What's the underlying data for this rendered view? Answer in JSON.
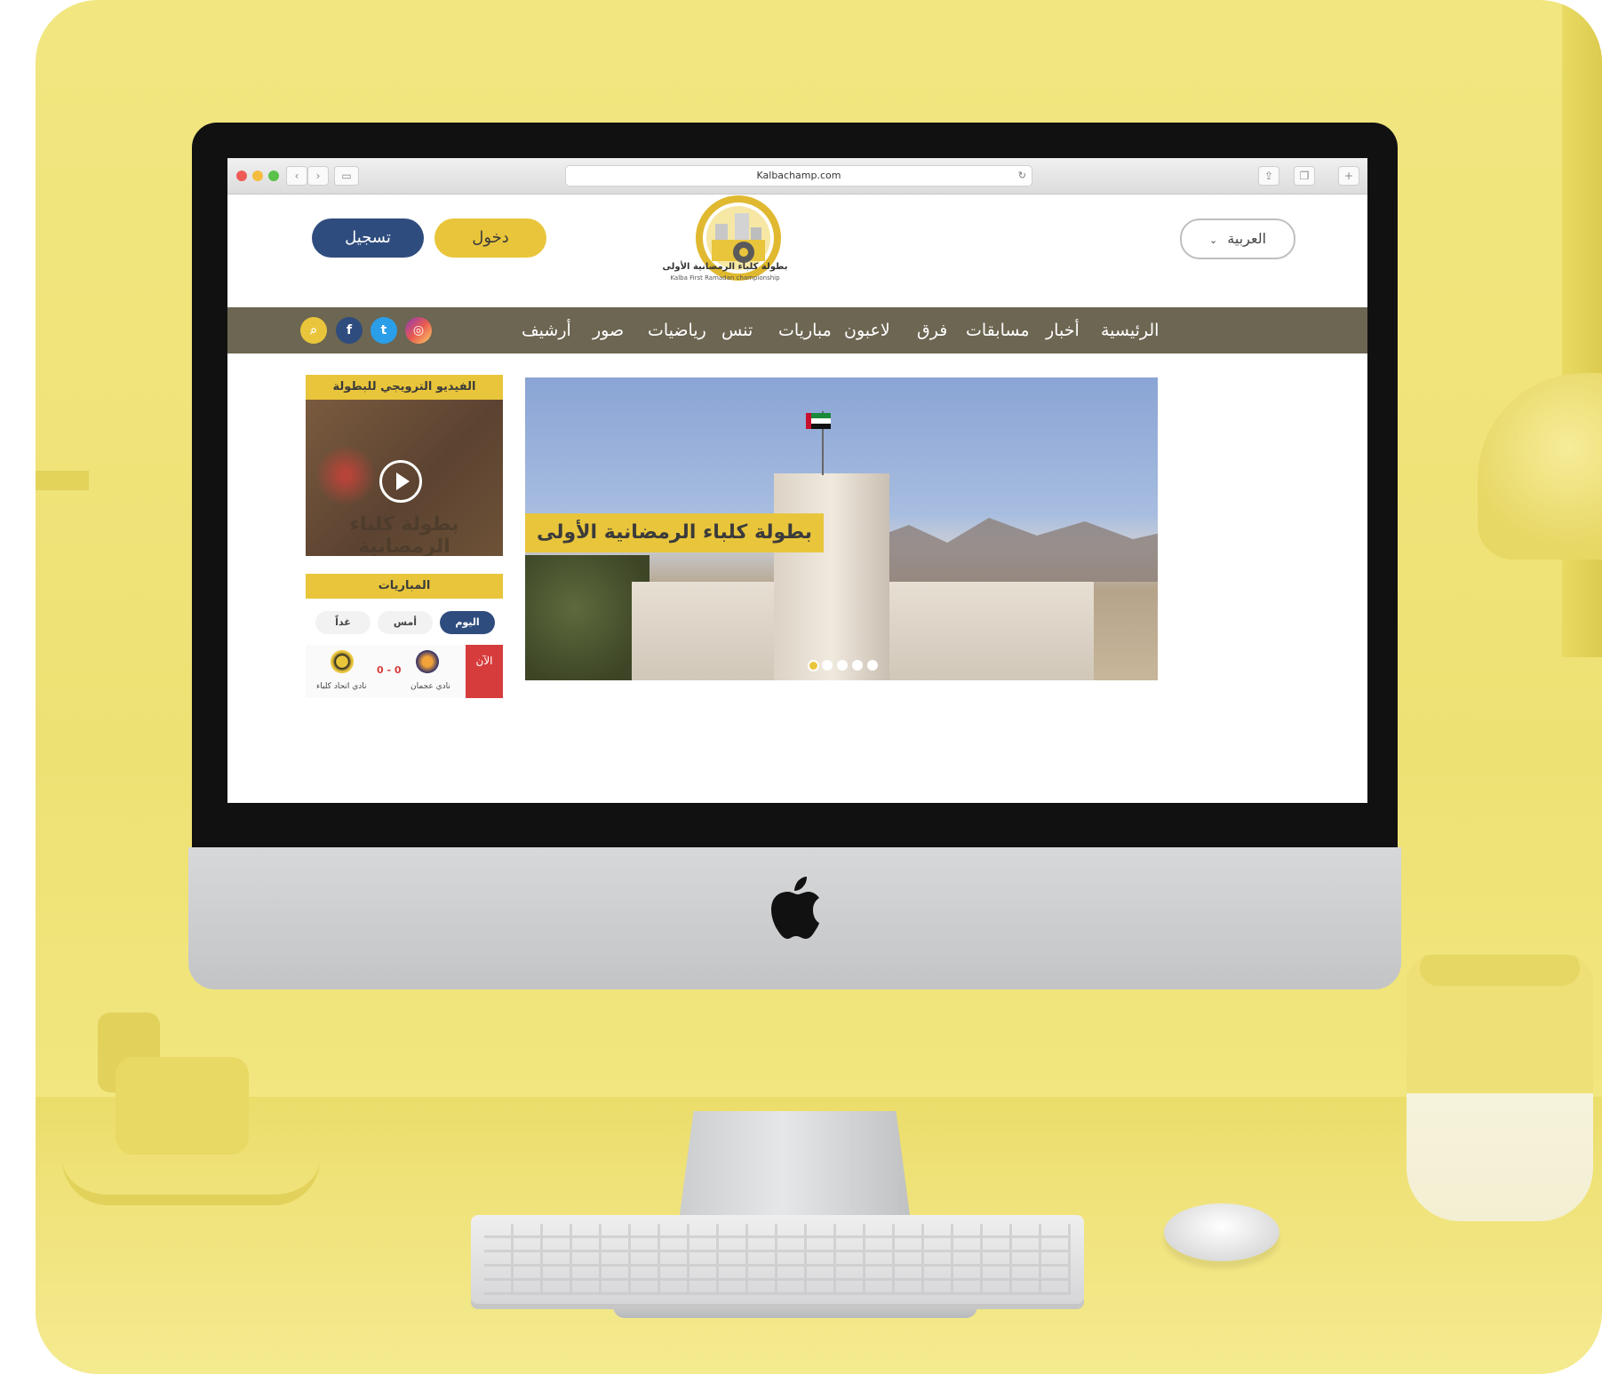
{
  "browser": {
    "url": "Kalbachamp.com"
  },
  "header": {
    "register_label": "تسجيل",
    "login_label": "دخول",
    "language_label": "العربية",
    "logo_title_ar": "بطولة كلباء الرمضانية الأولى",
    "logo_title_en": "Kalba First Ramadan championship"
  },
  "nav": {
    "items": [
      "الرئيسية",
      "أخبار",
      "مسابقات",
      "فرق",
      "لاعبون",
      "مباريات",
      "تنس",
      "رياضيات",
      "صور",
      "أرشيف"
    ]
  },
  "video_card": {
    "title": "الفيديو الترويجي للبطولة",
    "thumb_text": "بطولة كلباء الرمضانية"
  },
  "matches": {
    "title": "المباريات",
    "tabs": [
      "اليوم",
      "أمس",
      "غداً"
    ],
    "live_label": "الآن",
    "score": "0 - 0",
    "home_team": "نادي عجمان",
    "away_team": "نادي اتحاد كلباء"
  },
  "slider": {
    "caption": "بطولة كلباء الرمضانية الأولى",
    "slides": 5,
    "active_index": 0
  },
  "colors": {
    "brand_yellow": "#e9c53b",
    "brand_blue": "#2f4c7e",
    "nav_bg": "#6c6652",
    "background_yellow": "#eee174"
  }
}
